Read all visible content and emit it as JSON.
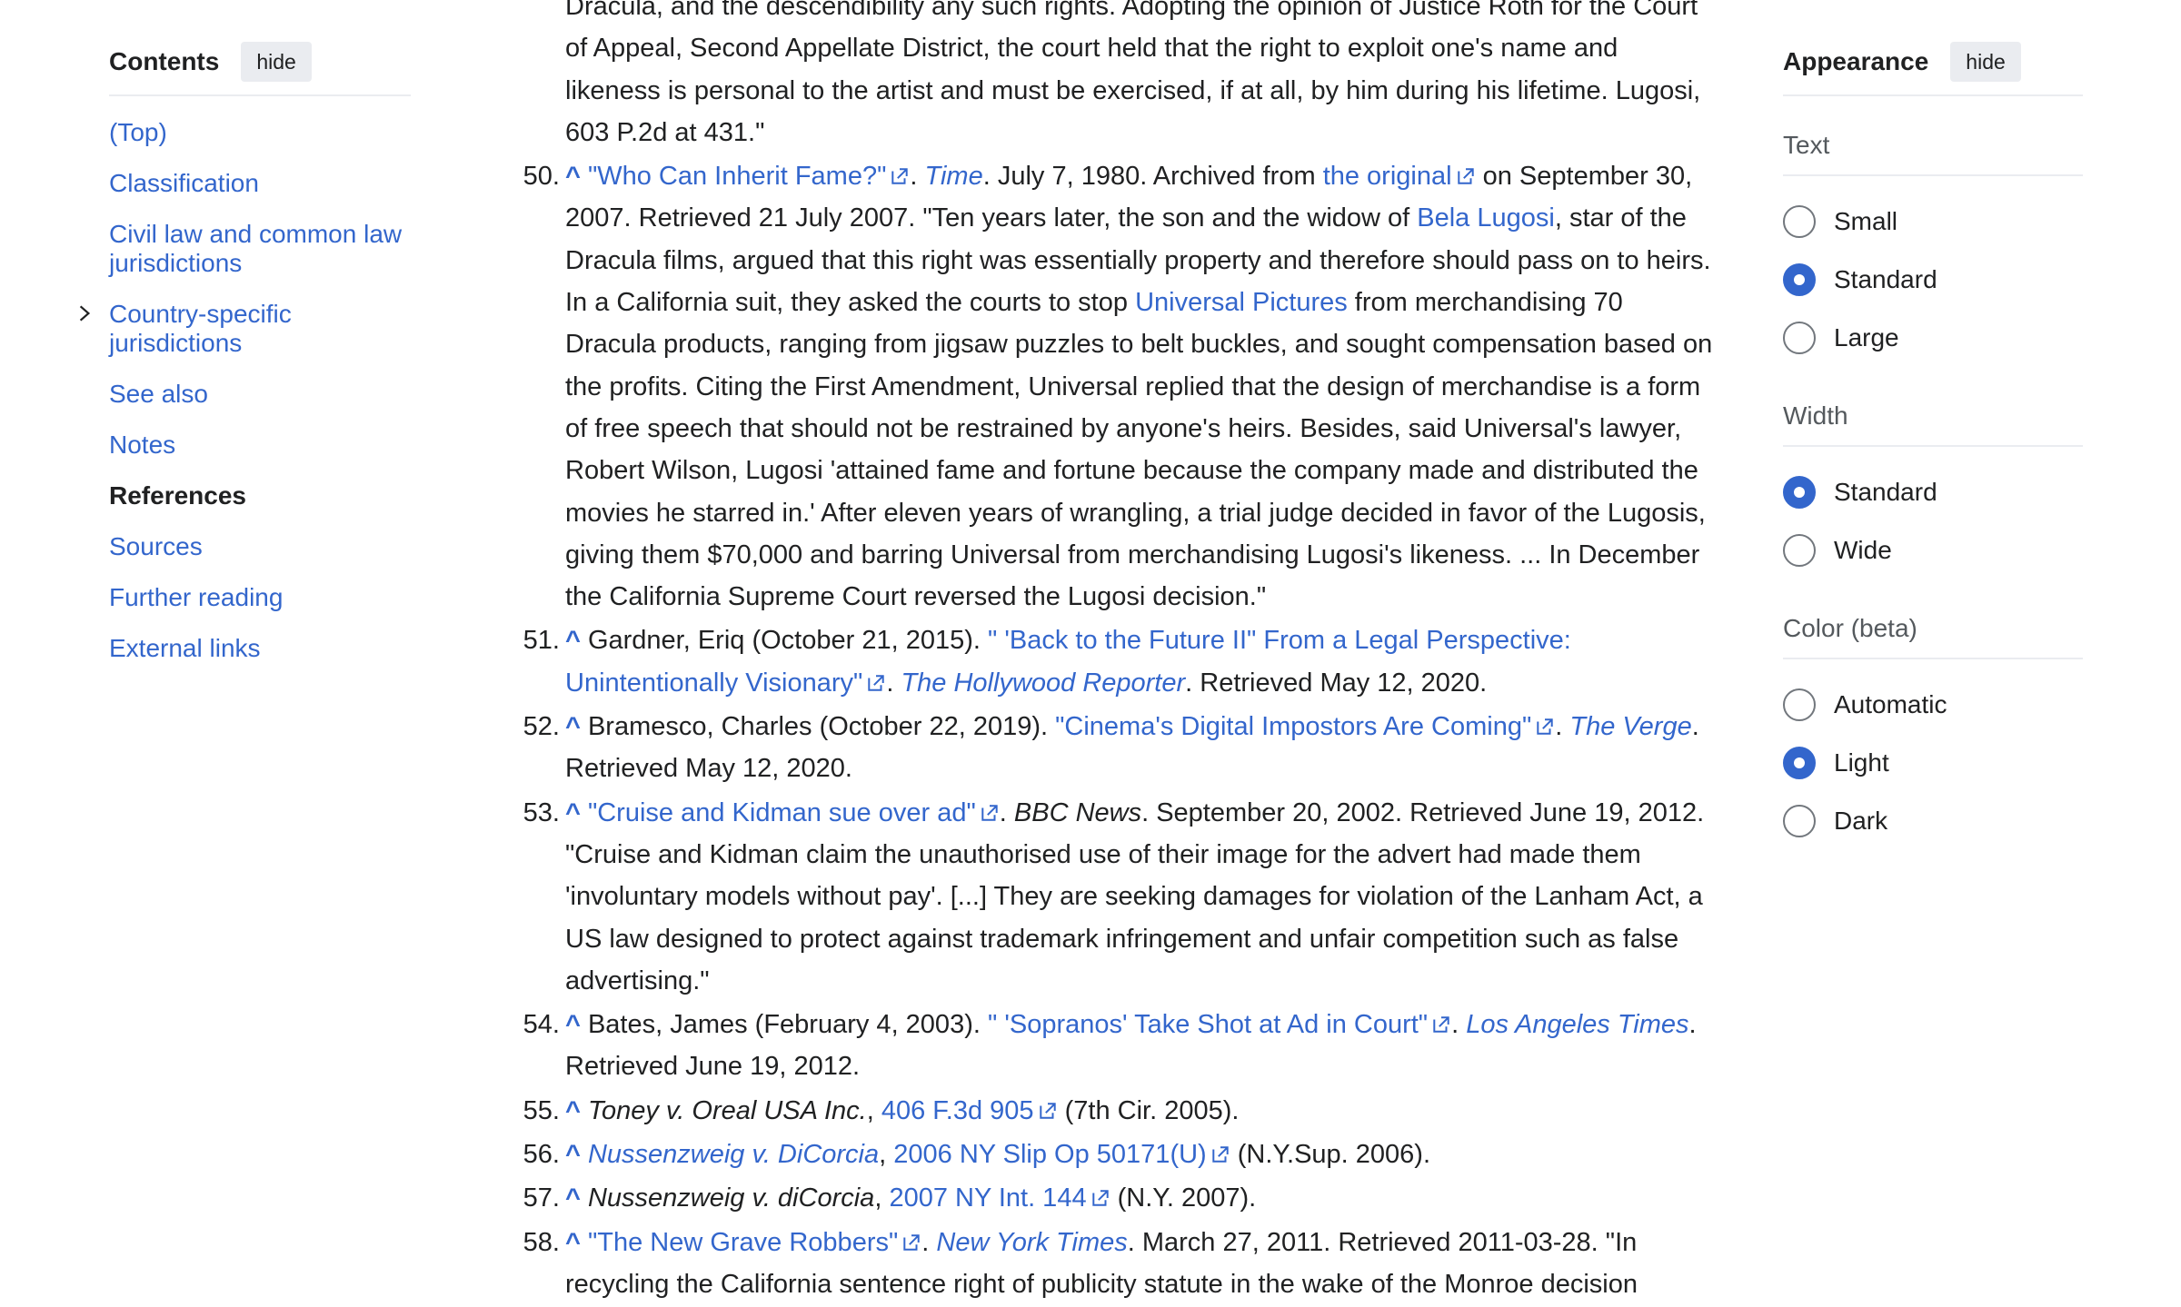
{
  "toc": {
    "title": "Contents",
    "hide_label": "hide",
    "items": [
      {
        "label": "(Top)"
      },
      {
        "label": "Classification"
      },
      {
        "label": "Civil law and common law jurisdictions"
      },
      {
        "label": "Country-specific jurisdictions"
      },
      {
        "label": "See also"
      },
      {
        "label": "Notes"
      },
      {
        "label": "References"
      },
      {
        "label": "Sources"
      },
      {
        "label": "Further reading"
      },
      {
        "label": "External links"
      }
    ]
  },
  "references": {
    "r49": {
      "l1": "Dracula, and the descendibility any such rights. Adopting the opinion of Justice Roth for the Court",
      "l2": "of Appeal, Second Appellate District, the court held that the right to exploit one's name and",
      "l3": "likeness is personal to the artist and must be exercised, if at all, by him during his lifetime. Lugosi,",
      "l4": "603 P.2d at 431.\""
    },
    "r50": {
      "num": "50.",
      "caret": "^",
      "title": "\"Who Can Inherit Fame?\"",
      "pub": "Time",
      "date": ". July 7, 1980. Archived from ",
      "orig": "the original",
      "t1": " on September 30, 2007. Retrieved 21 July 2007. \"Ten years later, the son and the widow of ",
      "bela": "Bela Lugosi",
      "t2": ", star of the Dracula films, argued that this right was essentially property and therefore should pass on to heirs. In a California suit, they asked the courts to stop ",
      "universal": "Universal Pictures",
      "t3": " from merchandising 70 Dracula products, ranging from jigsaw puzzles to belt buckles, and sought compensation based on the profits. Citing the First Amendment, Universal replied that the design of merchandise is a form of free speech that should not be restrained by anyone's heirs. Besides, said Universal's lawyer, Robert Wilson, Lugosi 'attained fame and fortune because the company made and distributed the movies he starred in.' After eleven years of wrangling, a trial judge decided in favor of the Lugosis, giving them $70,000 and barring Universal from merchandising Lugosi's likeness. ... In December the California Supreme Court reversed the Lugosi decision.\""
    },
    "r51": {
      "num": "51.",
      "caret": "^",
      "t1": "Gardner, Eriq (October 21, 2015). ",
      "title": "\" 'Back to the Future II\" From a Legal Perspective: Unintentionally Visionary\"",
      "pub": "The Hollywood Reporter",
      "t2": ". Retrieved May 12, 2020."
    },
    "r52": {
      "num": "52.",
      "caret": "^",
      "t1": "Bramesco, Charles (October 22, 2019). ",
      "title": "\"Cinema's Digital Impostors Are Coming\"",
      "pub": "The Verge",
      "t2": ". Retrieved May 12, 2020."
    },
    "r53": {
      "num": "53.",
      "caret": "^",
      "title": "\"Cruise and Kidman sue over ad\"",
      "pub": "BBC News",
      "t2": ". September 20, 2002. Retrieved June 19, 2012. \"Cruise and Kidman claim the unauthorised use of their image for the advert had made them 'involuntary models without pay'. [...] They are seeking damages for violation of the Lanham Act, a US law designed to protect against trademark infringement and unfair competition such as false advertising.\""
    },
    "r54": {
      "num": "54.",
      "caret": "^",
      "t1": "Bates, James (February 4, 2003). ",
      "title": "\" 'Sopranos' Take Shot at Ad in Court\"",
      "pub": "Los Angeles Times",
      "t2": ". Retrieved June 19, 2012."
    },
    "r55": {
      "num": "55.",
      "caret": "^",
      "case": "Toney v. Oreal USA Inc.",
      "sep": ", ",
      "cite": "406 F.3d 905",
      "t2": " (7th Cir. 2005)."
    },
    "r56": {
      "num": "56.",
      "caret": "^",
      "case": "Nussenzweig v. DiCorcia",
      "sep": ", ",
      "cite": "2006 NY Slip Op 50171(U)",
      "t2": " (N.Y.Sup. 2006)."
    },
    "r57": {
      "num": "57.",
      "caret": "^",
      "case": "Nussenzweig v. diCorcia",
      "sep": ", ",
      "cite": "2007 NY Int. 144",
      "t2": " (N.Y. 2007)."
    },
    "r58": {
      "num": "58.",
      "caret": "^",
      "title": "\"The New Grave Robbers\"",
      "pub": "New York Times",
      "t2": ". March 27, 2011. Retrieved 2011-03-28. \"In",
      "l2": "recycling the California sentence right of publicity statute in the wake of the Monroe decision"
    }
  },
  "appearance": {
    "title": "Appearance",
    "hide_label": "hide",
    "text_label": "Text",
    "text_options": [
      "Small",
      "Standard",
      "Large"
    ],
    "width_label": "Width",
    "width_options": [
      "Standard",
      "Wide"
    ],
    "color_label": "Color (beta)",
    "color_options": [
      "Automatic",
      "Light",
      "Dark"
    ]
  },
  "colors": {
    "link": "#3366cc",
    "text": "#202122",
    "muted": "#54595d",
    "accent": "#3366cc",
    "rule": "#eaecf0"
  }
}
